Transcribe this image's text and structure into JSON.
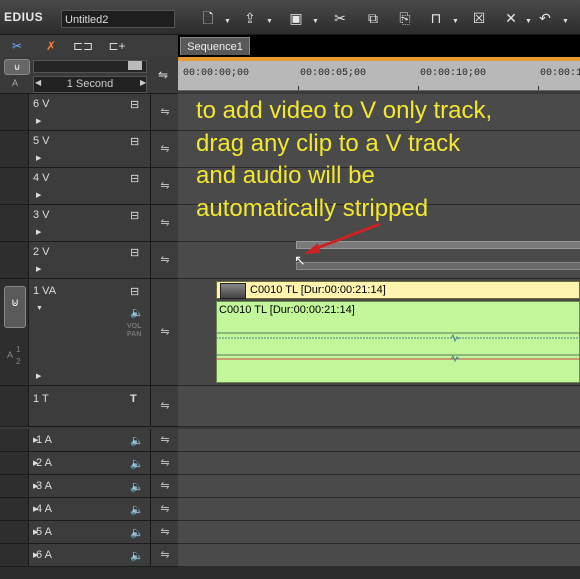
{
  "app": {
    "name": "EDIUS",
    "project": "Untitled2"
  },
  "toolbar": {
    "icons": [
      "new-project-icon",
      "open-project-icon",
      "save-project-icon",
      "cut-icon",
      "copy-icon",
      "paste-icon",
      "ripple-icon",
      "delete-icon",
      "ripple-delete-icon",
      "undo-icon"
    ]
  },
  "sequence": {
    "tab_label": "Sequence1"
  },
  "timescale": {
    "label": "1 Second"
  },
  "ruler": {
    "timecodes": [
      "00:00:00;00",
      "00:00:05;00",
      "00:00:10;00",
      "00:00:1"
    ]
  },
  "tracks": {
    "v6": "6 V",
    "v5": "5 V",
    "v4": "4 V",
    "v3": "3 V",
    "v2": "2 V",
    "va1": "1 VA",
    "t1": "1 T",
    "a1": "1 A",
    "a2": "2 A",
    "a3": "3 A",
    "a4": "4 A",
    "a5": "5 A",
    "a6": "6 A",
    "vol_pan": "VOL\nPAN",
    "a_gutter": "A",
    "a_gutter_nums": "1\n2"
  },
  "clips": {
    "video_label": "C0010  TL [Dur:00:00:21:14]",
    "audio_label": "C0010  TL [Dur:00:00:21:14]"
  },
  "annotation": {
    "text": "to add video to V only track,\ndrag any clip to a V track\nand audio will be\nautomatically stripped",
    "color": "#f2e830",
    "arrow_color": "#cc2222"
  },
  "colors": {
    "ruler_accent": "#e89c30",
    "video_clip": "#fff3b0",
    "audio_clip": "#c3f59a"
  }
}
